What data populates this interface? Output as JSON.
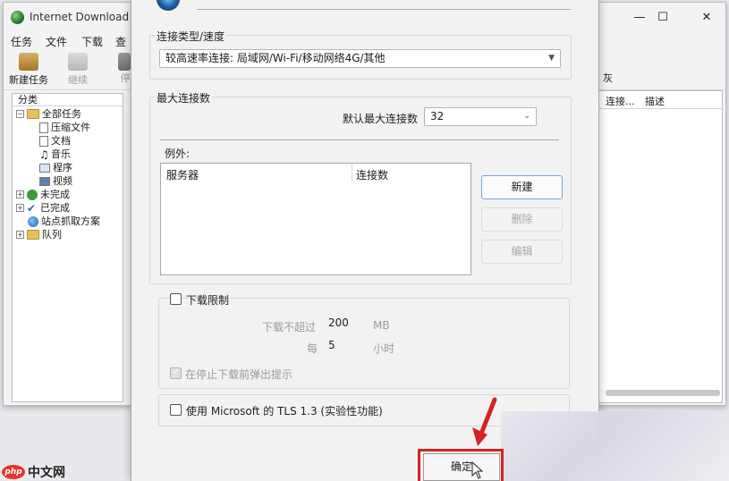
{
  "idm": {
    "title": "Internet Download M",
    "menu": [
      "任务",
      "文件",
      "下载",
      "查"
    ],
    "toolbar": {
      "new_task": "新建任务",
      "resume": "继续",
      "stop": "停",
      "right_text": "灰"
    },
    "categories_header": "分类",
    "tree": {
      "all": "全部任务",
      "compressed": "压缩文件",
      "documents": "文档",
      "music": "音乐",
      "programs": "程序",
      "video": "视频",
      "unfinished": "未完成",
      "finished": "已完成",
      "grabber": "站点抓取方案",
      "queues": "队列"
    },
    "list_columns": {
      "connections": "连接...",
      "description": "描述"
    }
  },
  "dialog": {
    "conn_type_group": "连接类型/速度",
    "conn_type_value": "较高速率连接: 局域网/Wi-Fi/移动网络4G/其他",
    "max_conn_group": "最大连接数",
    "default_max_label": "默认最大连接数",
    "default_max_value": "32",
    "exceptions_label": "例外:",
    "exc_col_server": "服务器",
    "exc_col_conns": "连接数",
    "btn_new": "新建",
    "btn_delete": "删除",
    "btn_edit": "编辑",
    "download_limit_label": "下载限制",
    "limit_up_to_label": "下载不超过",
    "limit_up_to_value": "200",
    "limit_up_to_unit": "MB",
    "limit_every_label": "每",
    "limit_every_value": "5",
    "limit_every_unit": "小时",
    "warn_before_stop": "在停止下载前弹出提示",
    "tls_label": "使用 Microsoft 的 TLS 1.3 (实验性功能)",
    "ok_button": "确定"
  },
  "watermark": {
    "logo": "php",
    "text": "中文网"
  },
  "colors": {
    "annotation_red": "#d42323",
    "watermark_red": "#e8322a"
  }
}
